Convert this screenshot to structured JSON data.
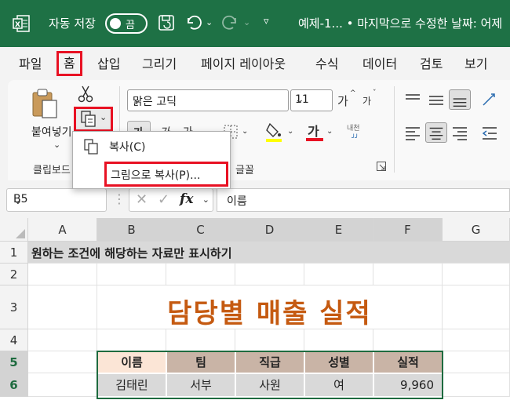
{
  "titlebar": {
    "autosave_label": "자동 저장",
    "toggle_state": "끔",
    "doc_title": "예제-1...  •  마지막으로 수정한 날짜: 어제"
  },
  "menu": {
    "tabs": [
      "파일",
      "홈",
      "삽입",
      "그리기",
      "페이지 레이아웃",
      "수식",
      "데이터",
      "검토",
      "보기"
    ],
    "active": "홈"
  },
  "ribbon": {
    "paste_label": "붙여넣기",
    "font_name": "맑은 고딕",
    "font_size": "11",
    "clipboard_group": "클립보드",
    "font_group": "글꼴",
    "font_increase": "가",
    "font_decrease": "가",
    "bold": "가",
    "italic": "가",
    "underline": "가",
    "font_color_glyph": "가",
    "phonetic": "내천"
  },
  "dropdown": {
    "copy_label": "복사(C)",
    "copy_picture_label": "그림으로 복사(P)..."
  },
  "formulabar": {
    "namebox": "B5",
    "fx": "fx",
    "content": "이름"
  },
  "grid": {
    "columns": [
      "A",
      "B",
      "C",
      "D",
      "E",
      "F",
      "G"
    ],
    "rows": [
      "1",
      "2",
      "3",
      "4",
      "5",
      "6"
    ],
    "a1": "원하는 조건에 해당하는 자료만 표시하기",
    "title": "담당별 매출 실적",
    "headers": [
      "이름",
      "팀",
      "직급",
      "성별",
      "실적"
    ],
    "row6": [
      "김태린",
      "서부",
      "사원",
      "여",
      "9,960"
    ]
  },
  "colors": {
    "titlebar_bg": "#1e7145",
    "highlight_red": "#e81123",
    "title_orange": "#c55a11",
    "header_bg": "#c9b4a6",
    "name_header_bg": "#fbe5d6",
    "data_bg": "#d9d9d9"
  }
}
